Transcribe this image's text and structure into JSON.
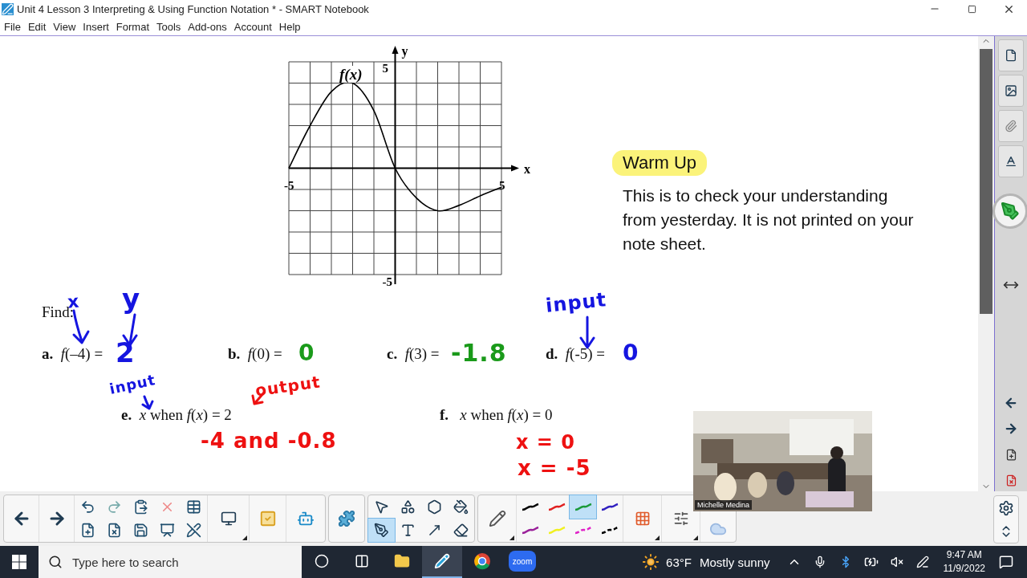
{
  "window": {
    "title": "Unit 4 Lesson 3 Interpreting & Using Function Notation * - SMART Notebook"
  },
  "menu": [
    "File",
    "Edit",
    "View",
    "Insert",
    "Format",
    "Tools",
    "Add-ons",
    "Account",
    "Help"
  ],
  "graph": {
    "chart_data": {
      "type": "line",
      "xlabel": "x",
      "ylabel": "y",
      "x": [
        -5,
        -4,
        -3,
        -2,
        -1,
        0,
        1,
        2,
        3,
        4,
        5
      ],
      "series": [
        {
          "name": "f(x)",
          "color": "#000000",
          "values": [
            0,
            2,
            3.6,
            4,
            2.7,
            0,
            -1.4,
            -2,
            -1.75,
            -1.3,
            -0.9
          ]
        }
      ],
      "xlim": [
        -5,
        5
      ],
      "ylim": [
        -5,
        5
      ],
      "xticks": [
        {
          "value": -5,
          "label": "-5"
        },
        {
          "value": 5,
          "label": "5"
        }
      ],
      "yticks": [
        {
          "value": -5,
          "label": "-5"
        },
        {
          "value": 5,
          "label": "5"
        }
      ]
    }
  },
  "warm_up": {
    "label": "Warm Up",
    "text": "This is to check your understanding from yesterday. It is not printed on your note sheet."
  },
  "problems": {
    "heading": "Find:",
    "items": [
      {
        "text": "**a.**  *f*(–4) ="
      },
      {
        "text": "**b.**  *f*(0) ="
      },
      {
        "text": "**c.**  *f*(3) ="
      },
      {
        "text": "**d.**  *f*(-5) ="
      },
      {
        "text": "**e.**  *x* when *f*(*x*) = 2"
      },
      {
        "text": "**f.**   *x* when *f*(*x*) = 0"
      }
    ]
  },
  "ink": [
    {
      "text": "x",
      "color": "#1515e0"
    },
    {
      "text": "y",
      "color": "#1515e0"
    },
    {
      "text": "2",
      "color": "#1515e0"
    },
    {
      "text": "0",
      "color": "#1a9a1a"
    },
    {
      "text": "-1.8",
      "color": "#1a9a1a"
    },
    {
      "text": "input",
      "color": "#1515e0"
    },
    {
      "text": "0",
      "color": "#1515e0"
    },
    {
      "text": "input",
      "color": "#1515e0"
    },
    {
      "text": "output",
      "color": "#ee1111"
    },
    {
      "text": "-4 and -0.8",
      "color": "#ee1111"
    },
    {
      "text": "x = 0",
      "color": "#ee1111"
    },
    {
      "text": "x = -5",
      "color": "#ee1111"
    }
  ],
  "video": {
    "caption": "Michelle Medina"
  },
  "toolbar": {
    "tools": [
      {
        "selected": false
      },
      {
        "selected": false
      },
      {
        "selected": false
      },
      {
        "selected": false
      },
      {
        "selected": true
      },
      {
        "selected": false
      },
      {
        "selected": false
      },
      {
        "selected": false
      }
    ],
    "pens": [
      {
        "kind": "solid",
        "color": "#000000",
        "selected": false
      },
      {
        "kind": "solid",
        "color": "#e02020",
        "selected": false
      },
      {
        "kind": "solid",
        "color": "#1a9a3a",
        "selected": true
      },
      {
        "kind": "solid",
        "color": "#3020c0",
        "selected": false
      },
      {
        "kind": "solid",
        "color": "#9a209a",
        "selected": false
      },
      {
        "kind": "solid",
        "color": "#f0f020",
        "selected": false
      },
      {
        "kind": "dashed",
        "color": "#e020c8",
        "selected": false
      },
      {
        "kind": "dashed",
        "color": "#000000",
        "selected": false
      }
    ]
  },
  "taskbar": {
    "search": {
      "placeholder": "Type here to search"
    },
    "apps": [
      {
        "selected": false
      },
      {
        "selected": false
      },
      {
        "selected": false
      },
      {
        "selected": true
      },
      {
        "selected": false
      },
      {
        "selected": false,
        "label": "zoom"
      }
    ],
    "weather": {
      "temp": "63°F",
      "text": "Mostly sunny"
    },
    "time": "9:47 AM",
    "date": "11/9/2022"
  }
}
